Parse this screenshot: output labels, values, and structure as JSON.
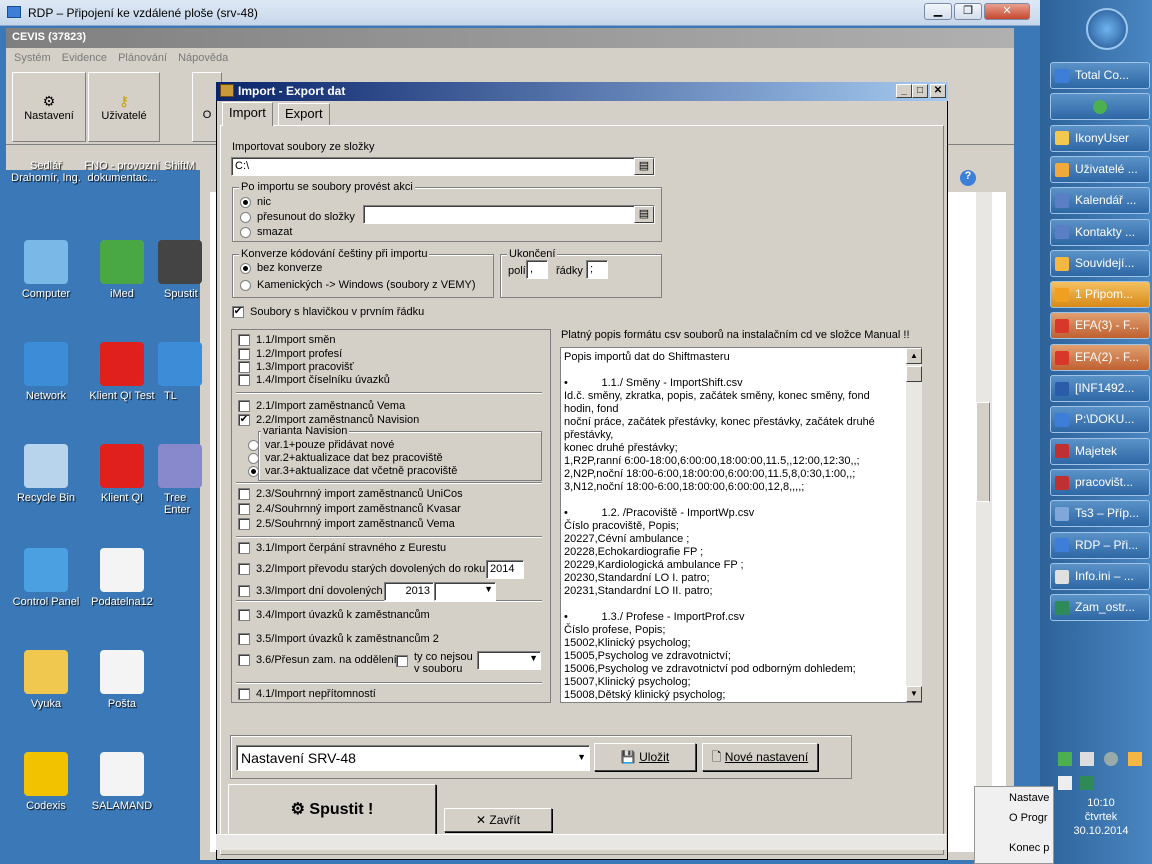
{
  "rdp": {
    "title": "RDP – Připojení ke vzdálené ploše (srv-48)"
  },
  "cevis": {
    "title": "CEVIS (37823)",
    "menu": [
      "Systém",
      "Evidence",
      "Plánování",
      "Nápověda"
    ],
    "toolbar": [
      "Nastavení",
      "Uživatelé",
      "O"
    ]
  },
  "desktop_icons": [
    {
      "label": "Sedlář Drahomír, Ing.",
      "icon": "person-folder-icon"
    },
    {
      "label": "FNO - provozní dokumentac...",
      "icon": "document-icon"
    },
    {
      "label": "ShiftM",
      "icon": "shortcut-icon"
    },
    {
      "label": "Computer",
      "icon": "computer-icon"
    },
    {
      "label": "iMed",
      "icon": "imed-icon"
    },
    {
      "label": "Spustit",
      "icon": "run-icon"
    },
    {
      "label": "Network",
      "icon": "network-icon"
    },
    {
      "label": "Klient QI Test",
      "icon": "klient-qi-icon"
    },
    {
      "label": "TL",
      "icon": "network-icon"
    },
    {
      "label": "Recycle Bin",
      "icon": "recycle-bin-icon"
    },
    {
      "label": "Klient QI",
      "icon": "klient-qi-icon"
    },
    {
      "label": "Tree Enter",
      "icon": "tree-icon"
    },
    {
      "label": "Control Panel",
      "icon": "control-panel-icon"
    },
    {
      "label": "Podatelna12",
      "icon": "document-icon"
    },
    {
      "label": "Vyuka",
      "icon": "folder-icon"
    },
    {
      "label": "Pošta",
      "icon": "document-icon"
    },
    {
      "label": "Codexis",
      "icon": "codexis-icon"
    },
    {
      "label": "SALAMAND",
      "icon": "document-icon"
    }
  ],
  "dialog": {
    "title": "Import - Export dat",
    "tabs": [
      "Import",
      "Export"
    ],
    "folder_label": "Importovat soubory ze složky",
    "folder_value": "C:\\",
    "after_import": {
      "legend": "Po importu se soubory provést akci",
      "options": [
        "nic",
        "přesunout do složky",
        "smazat"
      ],
      "selected": 0
    },
    "conversion": {
      "legend": "Konverze kódování češtiny při importu",
      "options": [
        "bez konverze",
        "Kamenických -> Windows  (soubory z VEMY)"
      ],
      "selected": 0
    },
    "ending": {
      "legend": "Ukončení",
      "poli_label": "polí",
      "poli_value": ",",
      "radky_label": "řádky",
      "radky_value": ";"
    },
    "header_check": "Soubory s hlavičkou v prvním řádku",
    "imports": [
      "1.1/Import směn",
      "1.2/Import profesí",
      "1.3/Import pracovišť",
      "1.4/Import číselníku úvazků",
      "2.1/Import zaměstnanců Vema",
      "2.2/Import zaměstnanců  Navision",
      "2.3/Souhrnný import zaměstnanců  UniCos",
      "2.4/Souhrnný import zaměstnanců Kvasar",
      "2.5/Souhrnný import zaměstnanců Vema",
      "3.1/Import čerpání stravného z Eurestu",
      "3.2/Import převodu starých dovolených do roku",
      "3.3/Import dní dovolených",
      "3.4/Import úvazků k zaměstnancům",
      "3.5/Import úvazků k zaměstnancům 2",
      "3.6/Přesun zam. na oddělení",
      "4.1/Import nepřítomností"
    ],
    "navision": {
      "legend": "varianta Navision",
      "options": [
        "var.1+pouze přidávat nové",
        "var.2+aktualizace dat bez pracoviště",
        "var.3+aktualizace dat včetně pracoviště"
      ],
      "selected": 2
    },
    "year_32": "2014",
    "year_33": "2013",
    "ty_co": "ty co nejsou v souboru",
    "info_label": "Platný popis formátu csv souborů na instalačním cd ve složce Manual !!",
    "memo": "Popis importů dat do Shiftmasteru\n\n•           1.1./ Směny - ImportShift.csv\nId.č. směny, zkratka, popis, začátek směny, konec směny, fond hodin, fond\nnoční práce, začátek přestávky, konec přestávky, začátek druhé přestávky,\nkonec druhé přestávky;\n1,R2P,ranní 6:00-18:00,6:00:00,18:00:00,11.5,,12:00,12:30,,;\n2,N2P,noční 18:00-6:00,18:00:00,6:00:00,11.5,8,0:30,1:00,,;\n3,N12,noční 18:00-6:00,18:00:00,6:00:00,12,8,,,,;\n\n•           1.2. /Pracoviště - ImportWp.csv\nČíslo pracoviště, Popis;\n20227,Cévní ambulance ;\n20228,Echokardiografie FP ;\n20229,Kardiologická ambulance FP ;\n20230,Standardní LO I. patro;\n20231,Standardní LO II. patro;\n\n•           1.3./ Profese - ImportProf.csv\nČíslo profese, Popis;\n15002,Klinický psycholog;\n15005,Psycholog ve zdravotnictví;\n15006,Psycholog ve zdravotnictví pod odborným dohledem;\n15007,Klinický psycholog;\n15008,Dětský klinický psycholog;",
    "settings_value": "Nastavení SRV-48",
    "save_label": "Uložit",
    "new_settings_label": "Nové nastavení",
    "run_label": "Spustit !",
    "close_label": "Zavřít"
  },
  "taskbar": {
    "items": [
      {
        "label": "Total Co...",
        "color": "#3d7fd8"
      },
      {
        "label": "",
        "color": "#4caf50"
      },
      {
        "label": "IkonyUser",
        "color": "#f2c94c"
      },
      {
        "label": "Uživatelé ...",
        "color": "#f2a93b"
      },
      {
        "label": "Kalendář ...",
        "color": "#5b7fc4"
      },
      {
        "label": "Kontakty ...",
        "color": "#5b7fc4"
      },
      {
        "label": "Souvidejí...",
        "color": "#f5b642"
      },
      {
        "label": "1 Připom...",
        "color": "#f0a020"
      },
      {
        "label": "EFA(3) - F...",
        "color": "#d8382c"
      },
      {
        "label": "EFA(2) - F...",
        "color": "#d8382c"
      },
      {
        "label": "[INF1492...",
        "color": "#2a5caa"
      },
      {
        "label": "P:\\DOKU...",
        "color": "#3d7fd8"
      },
      {
        "label": "Majetek",
        "color": "#c03030"
      },
      {
        "label": "pracovišt...",
        "color": "#c03030"
      },
      {
        "label": "Ts3 – Příp...",
        "color": "#7fa7d9"
      },
      {
        "label": "RDP – Při...",
        "color": "#3d7fd8"
      },
      {
        "label": "Info.ini – ...",
        "color": "#e0e0e0"
      },
      {
        "label": "Zam_ostr...",
        "color": "#2e8b57"
      }
    ],
    "time": "10:10",
    "day": "čtvrtek",
    "date": "30.10.2014",
    "context_menu": [
      "Nastave",
      "O Progr",
      "Konec p"
    ]
  }
}
